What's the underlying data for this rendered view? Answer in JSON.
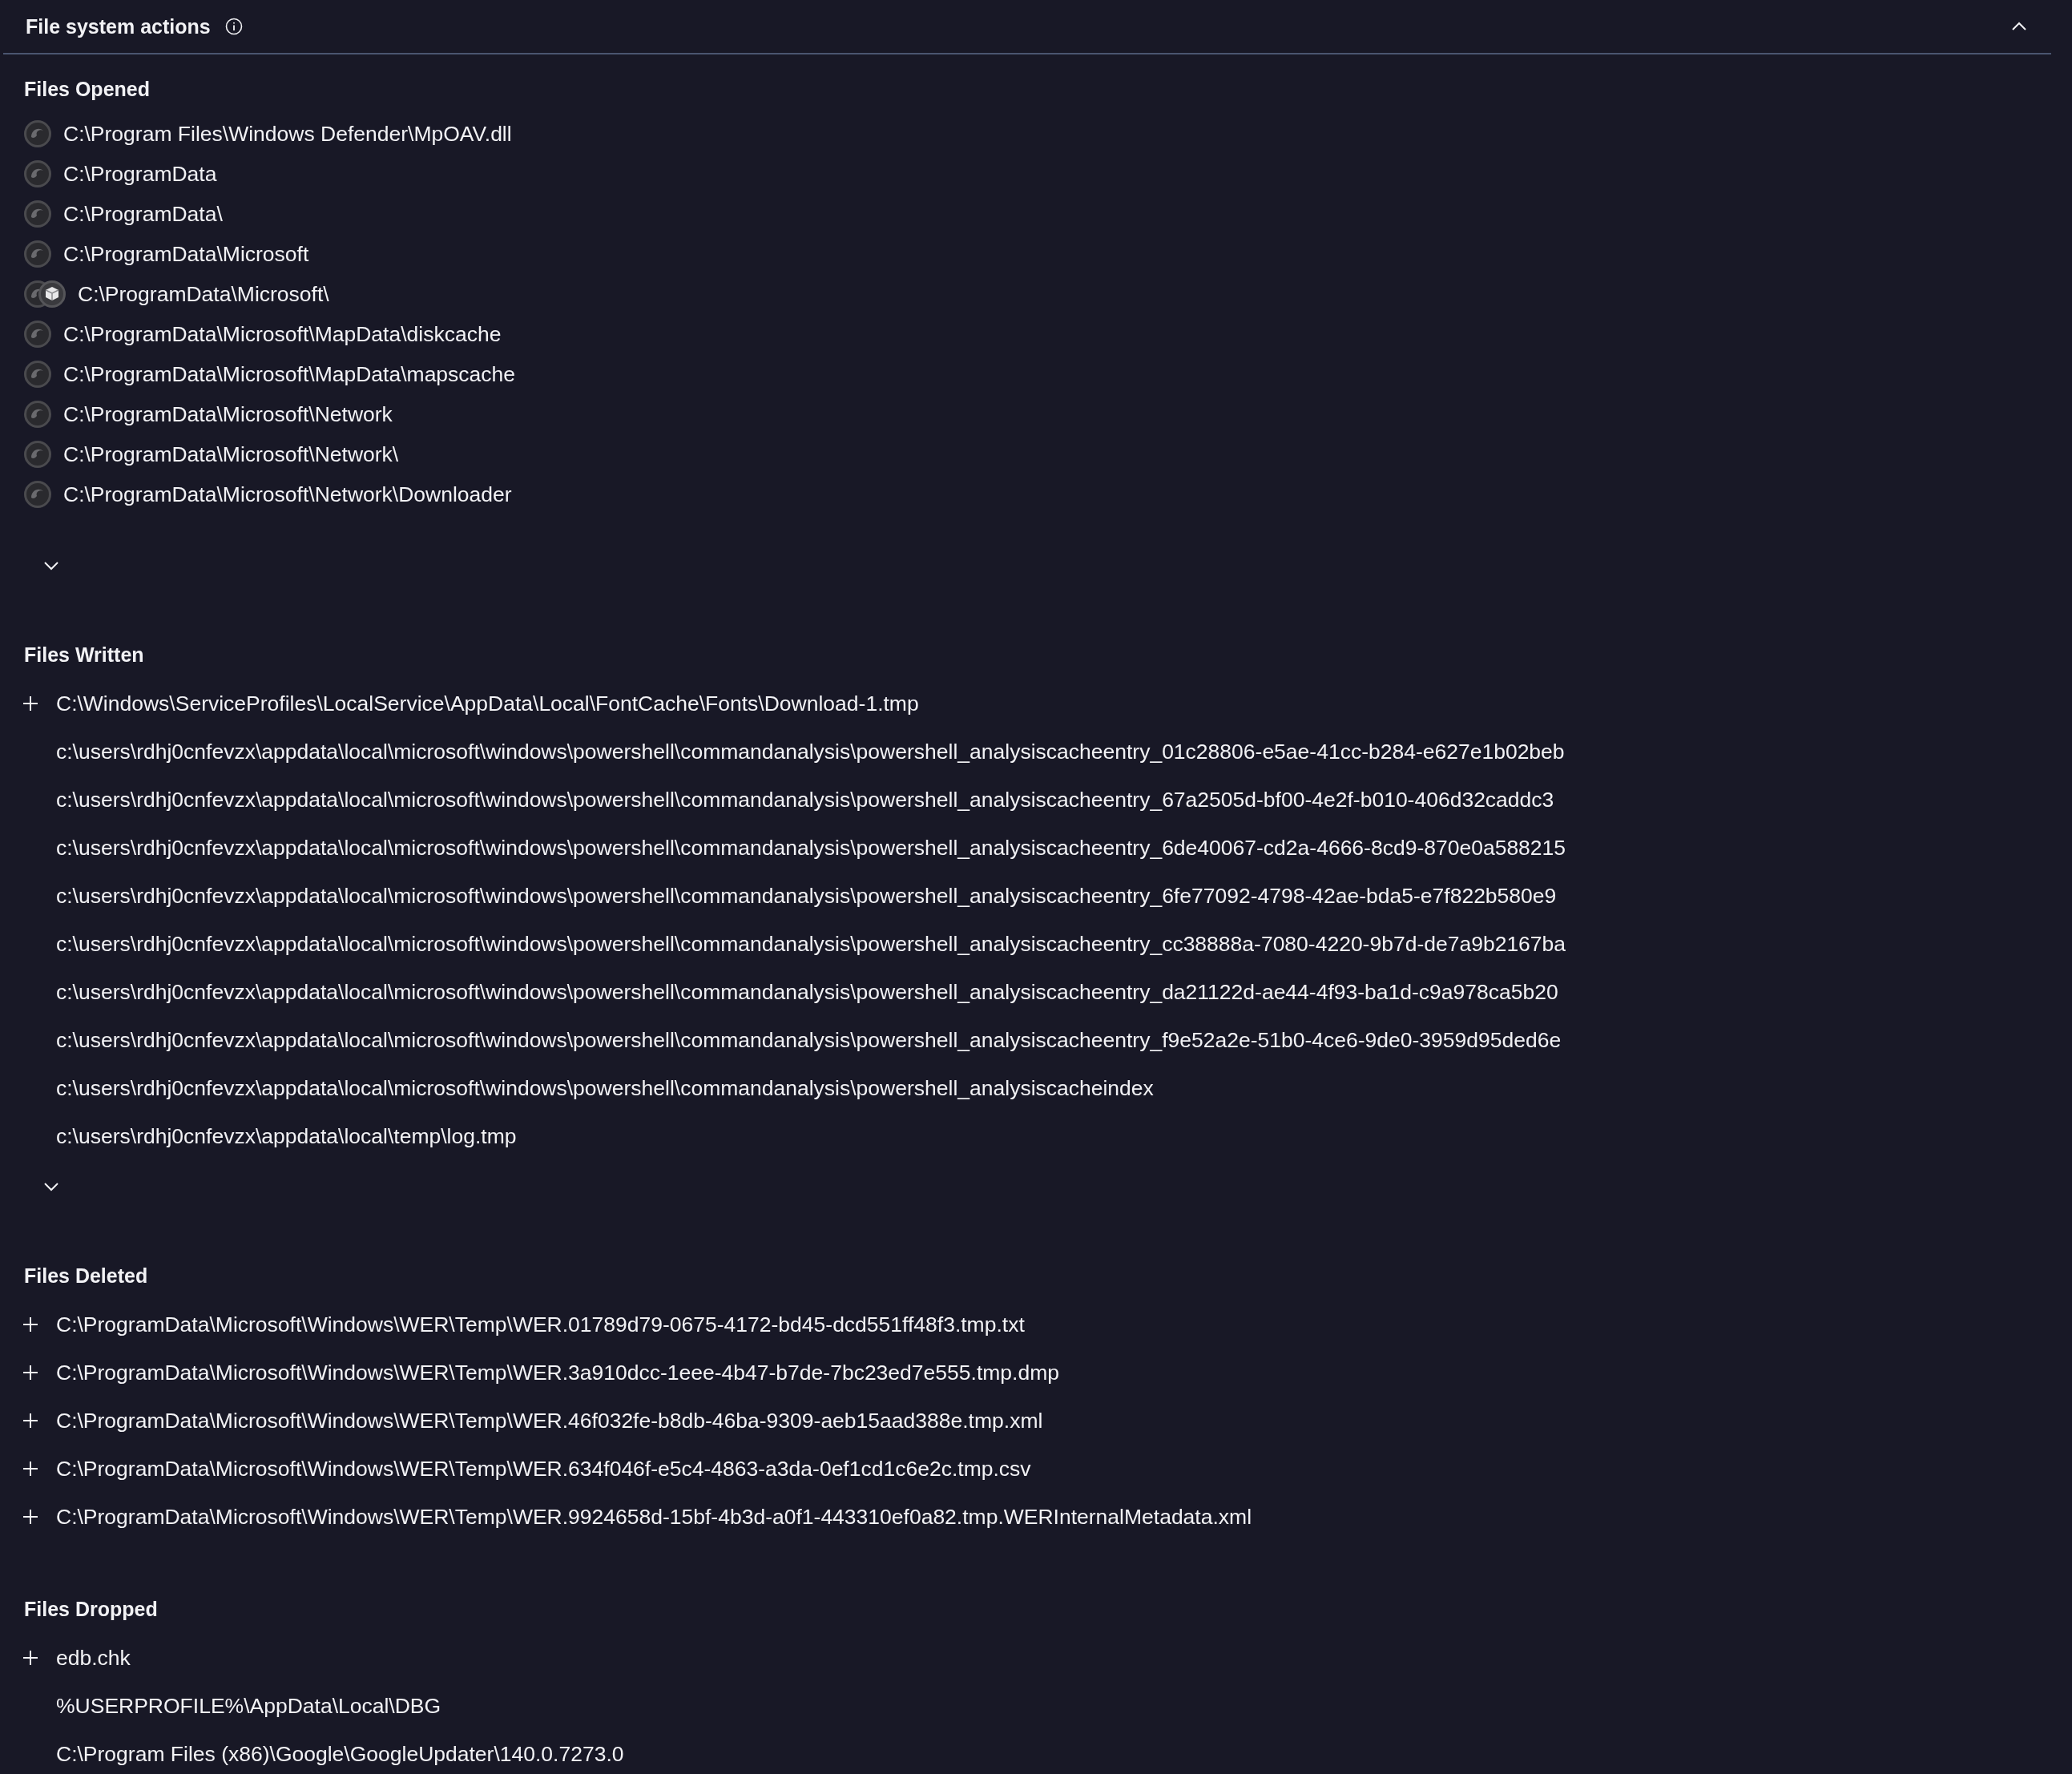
{
  "panel": {
    "title": "File system actions",
    "expanded": true
  },
  "sections": [
    {
      "title": "Files Opened",
      "kind": "opened",
      "show_more": true,
      "items": [
        {
          "path": "C:\\Program Files\\Windows Defender\\MpOAV.dll",
          "kind": "process"
        },
        {
          "path": "C:\\ProgramData",
          "kind": "process"
        },
        {
          "path": "C:\\ProgramData\\",
          "kind": "process"
        },
        {
          "path": "C:\\ProgramData\\Microsoft",
          "kind": "process"
        },
        {
          "path": "C:\\ProgramData\\Microsoft\\",
          "kind": "process-package"
        },
        {
          "path": "C:\\ProgramData\\Microsoft\\MapData\\diskcache",
          "kind": "process"
        },
        {
          "path": "C:\\ProgramData\\Microsoft\\MapData\\mapscache",
          "kind": "process"
        },
        {
          "path": "C:\\ProgramData\\Microsoft\\Network",
          "kind": "process"
        },
        {
          "path": "C:\\ProgramData\\Microsoft\\Network\\",
          "kind": "process"
        },
        {
          "path": "C:\\ProgramData\\Microsoft\\Network\\Downloader",
          "kind": "process"
        }
      ]
    },
    {
      "title": "Files Written",
      "kind": "tree",
      "show_more": true,
      "items": [
        {
          "path": "C:\\Windows\\ServiceProfiles\\LocalService\\AppData\\Local\\FontCache\\Fonts\\Download-1.tmp",
          "expandable": true
        },
        {
          "path": "c:\\users\\rdhj0cnfevzx\\appdata\\local\\microsoft\\windows\\powershell\\commandanalysis\\powershell_analysiscacheentry_01c28806-e5ae-41cc-b284-e627e1b02beb",
          "expandable": false
        },
        {
          "path": "c:\\users\\rdhj0cnfevzx\\appdata\\local\\microsoft\\windows\\powershell\\commandanalysis\\powershell_analysiscacheentry_67a2505d-bf00-4e2f-b010-406d32caddc3",
          "expandable": false
        },
        {
          "path": "c:\\users\\rdhj0cnfevzx\\appdata\\local\\microsoft\\windows\\powershell\\commandanalysis\\powershell_analysiscacheentry_6de40067-cd2a-4666-8cd9-870e0a588215",
          "expandable": false
        },
        {
          "path": "c:\\users\\rdhj0cnfevzx\\appdata\\local\\microsoft\\windows\\powershell\\commandanalysis\\powershell_analysiscacheentry_6fe77092-4798-42ae-bda5-e7f822b580e9",
          "expandable": false
        },
        {
          "path": "c:\\users\\rdhj0cnfevzx\\appdata\\local\\microsoft\\windows\\powershell\\commandanalysis\\powershell_analysiscacheentry_cc38888a-7080-4220-9b7d-de7a9b2167ba",
          "expandable": false
        },
        {
          "path": "c:\\users\\rdhj0cnfevzx\\appdata\\local\\microsoft\\windows\\powershell\\commandanalysis\\powershell_analysiscacheentry_da21122d-ae44-4f93-ba1d-c9a978ca5b20",
          "expandable": false
        },
        {
          "path": "c:\\users\\rdhj0cnfevzx\\appdata\\local\\microsoft\\windows\\powershell\\commandanalysis\\powershell_analysiscacheentry_f9e52a2e-51b0-4ce6-9de0-3959d95ded6e",
          "expandable": false
        },
        {
          "path": "c:\\users\\rdhj0cnfevzx\\appdata\\local\\microsoft\\windows\\powershell\\commandanalysis\\powershell_analysiscacheindex",
          "expandable": false
        },
        {
          "path": "c:\\users\\rdhj0cnfevzx\\appdata\\local\\temp\\log.tmp",
          "expandable": false
        }
      ]
    },
    {
      "title": "Files Deleted",
      "kind": "tree",
      "show_more": false,
      "items": [
        {
          "path": "C:\\ProgramData\\Microsoft\\Windows\\WER\\Temp\\WER.01789d79-0675-4172-bd45-dcd551ff48f3.tmp.txt",
          "expandable": true
        },
        {
          "path": "C:\\ProgramData\\Microsoft\\Windows\\WER\\Temp\\WER.3a910dcc-1eee-4b47-b7de-7bc23ed7e555.tmp.dmp",
          "expandable": true
        },
        {
          "path": "C:\\ProgramData\\Microsoft\\Windows\\WER\\Temp\\WER.46f032fe-b8db-46ba-9309-aeb15aad388e.tmp.xml",
          "expandable": true
        },
        {
          "path": "C:\\ProgramData\\Microsoft\\Windows\\WER\\Temp\\WER.634f046f-e5c4-4863-a3da-0ef1cd1c6e2c.tmp.csv",
          "expandable": true
        },
        {
          "path": "C:\\ProgramData\\Microsoft\\Windows\\WER\\Temp\\WER.9924658d-15bf-4b3d-a0f1-443310ef0a82.tmp.WERInternalMetadata.xml",
          "expandable": true
        }
      ]
    },
    {
      "title": "Files Dropped",
      "kind": "tree",
      "show_more": false,
      "items": [
        {
          "path": "edb.chk",
          "expandable": true
        },
        {
          "path": "%USERPROFILE%\\AppData\\Local\\DBG",
          "expandable": false
        },
        {
          "path": "C:\\Program Files (x86)\\Google\\GoogleUpdater\\140.0.7273.0",
          "expandable": false
        }
      ]
    }
  ]
}
